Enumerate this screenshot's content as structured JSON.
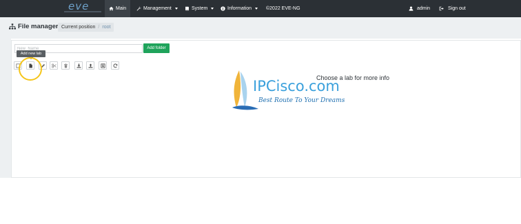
{
  "app": {
    "logo_text": "eve"
  },
  "nav": {
    "items": [
      {
        "label": "Main",
        "icon": "home-icon",
        "active": true
      },
      {
        "label": "Management",
        "icon": "wrench-icon",
        "dropdown": true
      },
      {
        "label": "System",
        "icon": "book-icon",
        "dropdown": true
      },
      {
        "label": "Information",
        "icon": "info-icon",
        "dropdown": true
      }
    ],
    "copyright": "©2022 EVE-NG",
    "user": {
      "label": "admin",
      "icon": "user-icon"
    },
    "signout": {
      "label": "Sign out",
      "icon": "signout-icon"
    }
  },
  "page": {
    "title": "File manager",
    "title_icon": "sitemap-icon",
    "breadcrumb": {
      "label": "Current position",
      "path": "root"
    }
  },
  "file_manager": {
    "name_input": {
      "placeholder": "New_Name",
      "value": ""
    },
    "add_folder_label": "Add folder",
    "tooltip": "Add new lab",
    "toolbar": [
      {
        "name": "select-all",
        "icon": "checkbox-icon"
      },
      {
        "name": "add-new-lab",
        "icon": "file-icon"
      },
      {
        "name": "rename",
        "icon": "pencil-icon"
      },
      {
        "name": "cut",
        "icon": "scissors-icon"
      },
      {
        "name": "delete",
        "icon": "trash-icon"
      },
      {
        "name": "import",
        "icon": "download-icon"
      },
      {
        "name": "export",
        "icon": "upload-icon"
      },
      {
        "name": "unlock",
        "icon": "unlock-icon"
      },
      {
        "name": "refresh",
        "icon": "refresh-icon"
      }
    ],
    "lab_info_placeholder": "Choose a lab for more info"
  },
  "watermark": {
    "brand": "IPCisco.com",
    "slogan": "Best Route To Your Dreams"
  },
  "colors": {
    "topbar": "#2b3035",
    "accent_green": "#1fa35b",
    "highlight_circle": "#f5c518",
    "watermark_blue": "#3aa0dc"
  }
}
